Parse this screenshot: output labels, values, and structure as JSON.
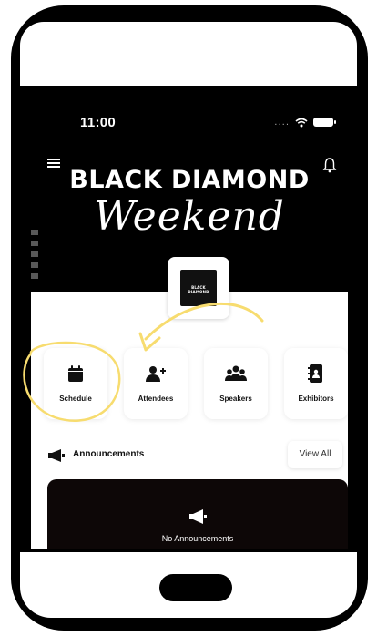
{
  "status_bar": {
    "time": "11:00",
    "signal": "....",
    "wifi_icon": "wifi-icon",
    "battery_icon": "battery-icon"
  },
  "header": {
    "menu_icon": "hamburger-menu-icon",
    "bell_icon": "bell-icon",
    "brand_title": "BLACK DIAMOND",
    "brand_script": "Weekend"
  },
  "logo_tile": {
    "text": "BLACK DIAMOND"
  },
  "quick_actions": [
    {
      "label": "Schedule",
      "icon": "calendar-icon"
    },
    {
      "label": "Attendees",
      "icon": "add-person-icon"
    },
    {
      "label": "Speakers",
      "icon": "group-icon"
    },
    {
      "label": "Exhibitors",
      "icon": "contact-book-icon"
    }
  ],
  "announcements": {
    "title": "Announcements",
    "view_all": "View All",
    "empty_text": "No Announcements",
    "icon": "megaphone-icon"
  },
  "annotation": {
    "highlight_target": "Schedule",
    "color": "#f7dc6f"
  },
  "colors": {
    "brand_dark": "#000000",
    "card_dark": "#0d0707",
    "highlight": "#f7dc6f",
    "phone_frame": "#000000"
  }
}
